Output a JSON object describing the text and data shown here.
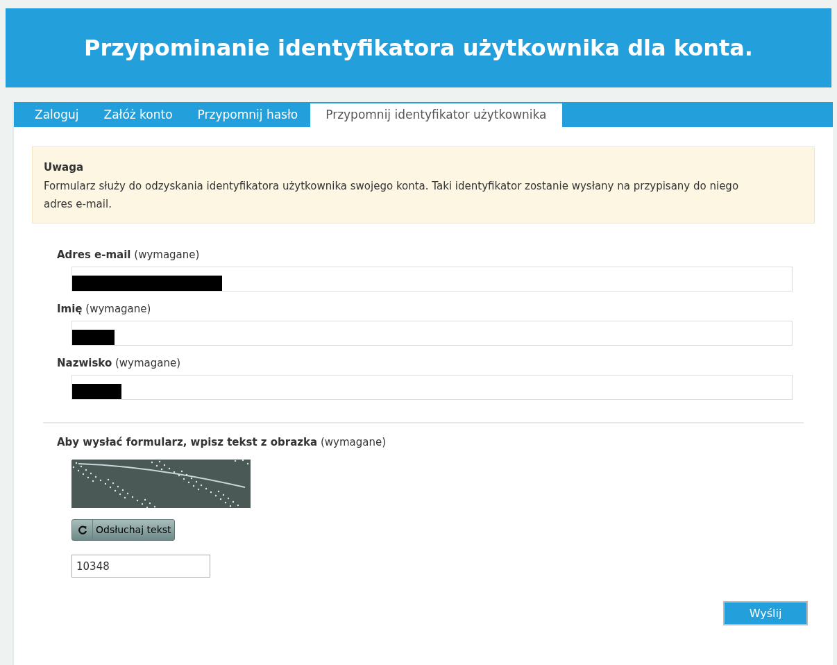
{
  "header": {
    "title": "Przypominanie identyfikatora użytkownika dla konta."
  },
  "tabs": [
    {
      "label": "Zaloguj",
      "selected": false
    },
    {
      "label": "Załóż konto",
      "selected": false
    },
    {
      "label": "Przypomnij hasło",
      "selected": false
    },
    {
      "label": "Przypomnij identyfikator użytkownika",
      "selected": true
    }
  ],
  "notice": {
    "title": "Uwaga",
    "text": "Formularz służy do odzyskania identyfikatora użytkownika swojego konta. Taki identyfikator zostanie wysłany na przypisany do niego adres e-mail."
  },
  "fields": [
    {
      "label": "**Adres e-mail** (wymagane)",
      "redacted": true
    },
    {
      "label": "**Imię** (wymagane)",
      "redacted": true
    },
    {
      "label": "**Nazwisko** (wymagane)",
      "redacted": true
    }
  ],
  "captcha": {
    "label": "**Aby wysłać formularz, wpisz tekst z obrazka** (wymagane)",
    "audio_button": "Odsłuchaj tekst",
    "value": "10348"
  },
  "submit": "Wyślij"
}
